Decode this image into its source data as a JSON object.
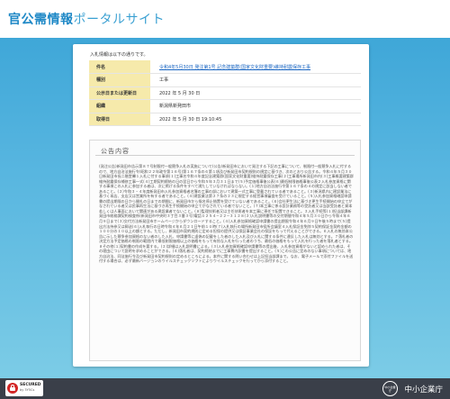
{
  "header": {
    "title_main": "官公需情報",
    "title_sub": "ポータルサイト"
  },
  "intro_text": "入札情報は以下の通りです。",
  "info_rows": [
    {
      "label": "件名",
      "value": "令和4年5月30日 発注第1号 記念建築群(国家文化財重要)維持耐震保存工事",
      "link": true
    },
    {
      "label": "種別",
      "value": "工事",
      "link": false
    },
    {
      "label": "公示日または更新日",
      "value": "2022 年 5 月 30 日",
      "link": false
    },
    {
      "label": "組織",
      "value": "新潟県新発田市",
      "link": false
    },
    {
      "label": "取得日",
      "value": "2022 年 5 月 30 日 19:10:45",
      "link": false
    }
  ],
  "notice": {
    "title": "公告内容",
    "body": "(発注公告)新発田市告示第８７号制限付一般競争入札の実施について(公告)新発田市において発注する下記の工事について、制限付一般競争入札に付するので、地方自治法施行令(昭和２２年政令第１６号)第１６７条の６第１項及び新発田市契約規則の規定に基づき、次のとおり公告する。令和４年５月３０日新発田市長二階堂馨１入札に付する事項(１)工事名令和４年度記念建築群(国家文化財重要)維持耐震保存工事(２)工事場所新発田市内(３)工事概要建築群維持耐震保存補修工事一式(４)工期契約締結の日の翌日から令和５年３月３１日まで(５)予定価格事後公表(６)最低制限価格事後公表２入札参加資格に関する事項この入札に参加する者は、次に掲げる条件をすべて満たしていなければならない。(１)地方自治法施行令第１６７条の４の規定に該当しない者であること。(２)令和３・４年度新発田市入札参加資格者名簿の工事の部において建築一式工事に登載されている者であること。(３)新潟県内に建設業法に基づく本店、支店又は営業所を有する者であること。(４)建設業法第２７条の２３に規定する経営事項審査を受けていること。(５)入札参加資格確認申請書の提出期限の日から開札の日までの期間に、新発田市から指名停止措置を受けていない者であること。(６)会社更生法に基づき更生手続開始の申立てがなされている者又は民事再生法に基づき再生手続開始の申立てがなされている者でないこと。(７)本工事に係る設計業務等の受託者又は当該受託者と資本若しくは人事面において関連がある建設業者でないこと。(８)監理技術者又は主任技術者を本工事に専任で配置できること。３入札手続等(１)担当部課新発田市総務課契約検査係(新発田市中央町３丁目３番３号)電話０２５４−２２−３１２８(２)入札説明書等の交付期間令和４年５月３０日から令和４年６月９日まで(３)交付方法新発田市ホームページからダウンロードすること。(４)入札参加資格確認申請書の提出期限令和４年６月９日午後５時まで(５)提出方法持参又は郵送(６)入札執行の日時令和４年６月２１日午前１０時(７)入札執行の場所新発田市役所会議室４入札保証金免除５契約保証金契約金額の１００分の１０以上の額とする。ただし、新発田市契約規則に定める担保の提供又は保証事業会社の保証をもって代えることができる。６入札の無効本公告に示した競争参加資格のない者のした入札、申請書等に虚偽の記載をした者のした入札及び入札に関する条件に違反した入札は無効とする。７落札者の決定方法予定価格の制限の範囲内で最低制限価格以上の価格をもって有効な入札を行った者のうち、最低の価格をもって入札を行った者を落札者とする。８その他(１)契約書の作成を要する。(２)詳細は入札説明書による。(３)入札参加資格確認申請書等の提出後、入札参加資格がないと認められた者は、その理由について説明を求めることができる。(４)落札者は、契約締結までに工事費内訳書を提出すること。(５)この公告に定めのない事項については、地方自治法、同法施行令及び新発田市契約規則の定めるところによる。本件に関する問い合わせは上記担当部課まで。なお、電子メールで添付ファイルを送付する場合は、必ず最新バージョンのウイルスチェックソフトによりウイルスチェックを行ってから添付すること。"
  },
  "footer": {
    "secured_label": "SECURED",
    "secured_sub": "by 3Y5Cs",
    "agency_emblem": "中小企業庁",
    "agency_name": "中小企業庁"
  },
  "colors": {
    "header_accent": "#1e88c6",
    "label_bg": "#f6eaab",
    "link": "#1a66c2",
    "footer_bg": "#3a3f49",
    "lock_red": "#d32626"
  }
}
